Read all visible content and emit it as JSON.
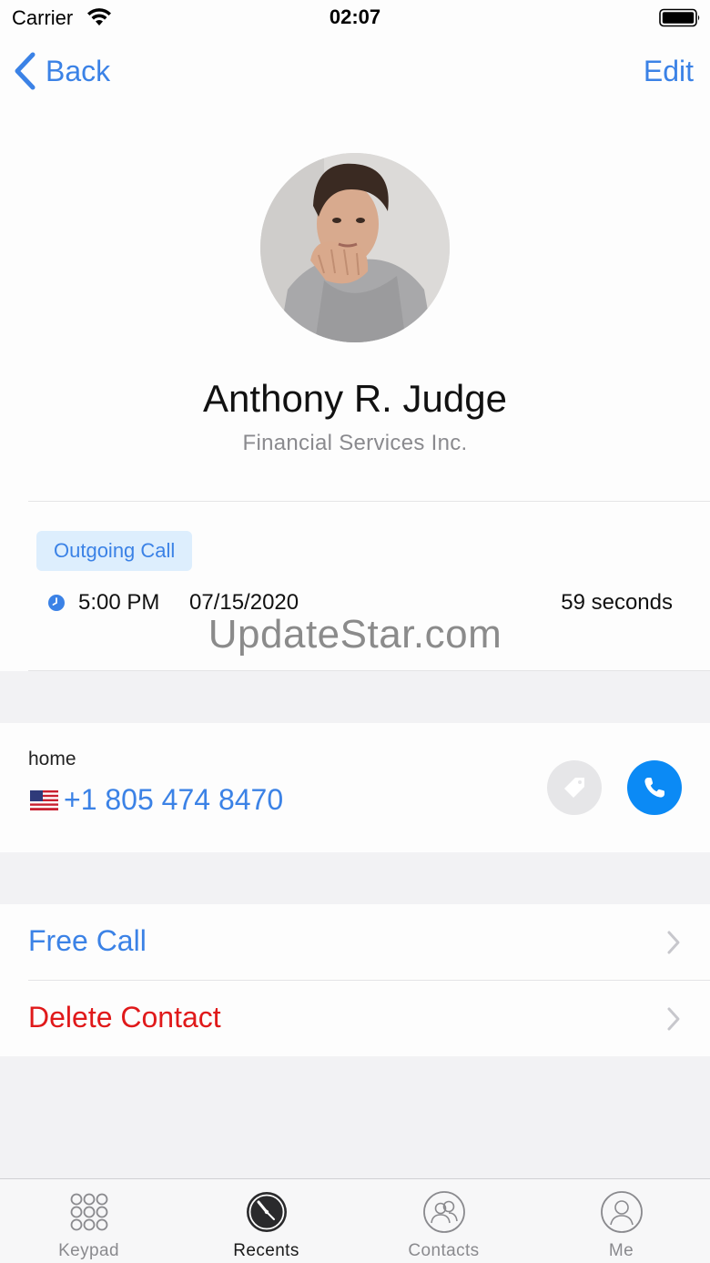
{
  "status_bar": {
    "carrier": "Carrier",
    "time": "02:07"
  },
  "nav": {
    "back_label": "Back",
    "edit_label": "Edit"
  },
  "contact": {
    "name": "Anthony R. Judge",
    "company": "Financial Services Inc."
  },
  "call_log": {
    "badge": "Outgoing Call",
    "time": "5:00 PM",
    "date": "07/15/2020",
    "duration": "59 seconds"
  },
  "watermark": "UpdateStar.com",
  "phone": {
    "label": "home",
    "number": "+1 805 474 8470",
    "flag": "us-flag-icon"
  },
  "actions": {
    "free_call": "Free Call",
    "delete_contact": "Delete Contact"
  },
  "tabs": [
    {
      "label": "Keypad",
      "icon": "keypad-icon"
    },
    {
      "label": "Recents",
      "icon": "recents-icon",
      "active": true
    },
    {
      "label": "Contacts",
      "icon": "contacts-icon"
    },
    {
      "label": "Me",
      "icon": "me-icon"
    }
  ],
  "colors": {
    "accent": "#3b82e6",
    "call_button": "#0b8af5",
    "destructive": "#e0191a",
    "badge_bg": "#ddeefd"
  }
}
